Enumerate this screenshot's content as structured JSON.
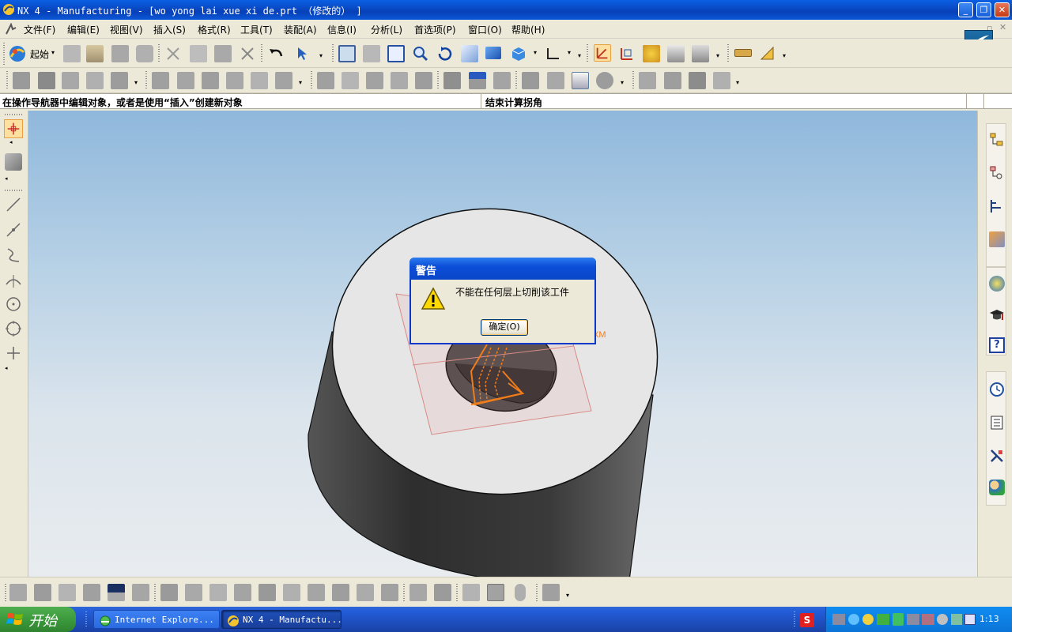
{
  "window": {
    "title": "NX 4 - Manufacturing - [wo yong lai xue xi de.prt （修改的） ]",
    "minimize": "_",
    "restore": "❐",
    "close": "✕"
  },
  "menubar": {
    "items": [
      "文件(F)",
      "编辑(E)",
      "视图(V)",
      "插入(S)",
      "格式(R)",
      "工具(T)",
      "装配(A)",
      "信息(I)",
      "分析(L)",
      "首选项(P)",
      "窗口(O)",
      "帮助(H)"
    ]
  },
  "toolbar": {
    "start_label": "起始"
  },
  "status": {
    "left": "在操作导航器中编辑对象，或者是使用“插入”创建新对象",
    "right": "结束计算拐角"
  },
  "dialog": {
    "title": "警告",
    "message": "不能在任何层上切削该工件",
    "ok_label": "确定(O)"
  },
  "viewport": {
    "axis_label": "XM"
  },
  "taskbar": {
    "start_label": "开始",
    "tasks": [
      "Internet Explore...",
      "NX 4 - Manufactu..."
    ],
    "clock": "1:13"
  },
  "colors": {
    "accent": "#0a58d8",
    "tool_orange": "#f07c1a",
    "part_dark": "#3c3c3c",
    "part_top": "#e6e6e6"
  }
}
